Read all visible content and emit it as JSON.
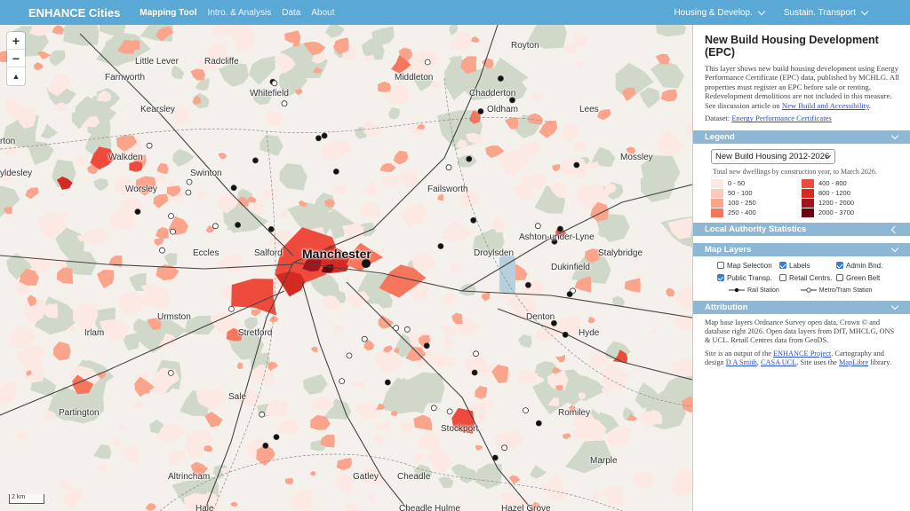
{
  "nav": {
    "brand": "ENHANCE Cities",
    "links": [
      "Mapping Tool",
      "Intro. & Analysis",
      "Data",
      "About"
    ],
    "dropdowns": [
      "Housing & Develop.",
      "Sustain. Transport"
    ]
  },
  "map": {
    "zoom_in": "+",
    "zoom_out": "−",
    "compass": "▲",
    "scale": "2 km",
    "places": [
      {
        "name": "Royton",
        "cls": ""
      },
      {
        "name": "Little Lever",
        "cls": ""
      },
      {
        "name": "Radcliffe",
        "cls": ""
      },
      {
        "name": "Farnworth",
        "cls": ""
      },
      {
        "name": "Middleton",
        "cls": ""
      },
      {
        "name": "Whitefield",
        "cls": ""
      },
      {
        "name": "Chadderton",
        "cls": ""
      },
      {
        "name": "Kearsley",
        "cls": ""
      },
      {
        "name": "Oldham",
        "cls": ""
      },
      {
        "name": "Lees",
        "cls": ""
      },
      {
        "name": "Walkden",
        "cls": ""
      },
      {
        "name": "Mossley",
        "cls": ""
      },
      {
        "name": "Swinton",
        "cls": ""
      },
      {
        "name": "Worsley",
        "cls": ""
      },
      {
        "name": "Failsworth",
        "cls": ""
      },
      {
        "name": "Ashton-under-Lyne",
        "cls": ""
      },
      {
        "name": "Eccles",
        "cls": ""
      },
      {
        "name": "Salford",
        "cls": ""
      },
      {
        "name": "Manchester",
        "cls": "city"
      },
      {
        "name": "Droylsden",
        "cls": ""
      },
      {
        "name": "Stalybridge",
        "cls": ""
      },
      {
        "name": "Dukinfield",
        "cls": ""
      },
      {
        "name": "Urmston",
        "cls": ""
      },
      {
        "name": "Denton",
        "cls": ""
      },
      {
        "name": "Irlam",
        "cls": ""
      },
      {
        "name": "Stretford",
        "cls": ""
      },
      {
        "name": "Hyde",
        "cls": ""
      },
      {
        "name": "Sale",
        "cls": ""
      },
      {
        "name": "Partington",
        "cls": ""
      },
      {
        "name": "Romiley",
        "cls": ""
      },
      {
        "name": "Stockport",
        "cls": ""
      },
      {
        "name": "Marple",
        "cls": ""
      },
      {
        "name": "Altrincham",
        "cls": ""
      },
      {
        "name": "Gatley",
        "cls": ""
      },
      {
        "name": "Cheadle",
        "cls": ""
      },
      {
        "name": "Hale",
        "cls": ""
      },
      {
        "name": "Cheadle Hulme",
        "cls": ""
      },
      {
        "name": "Hazel Grove",
        "cls": ""
      },
      {
        "name": "rton",
        "cls": ""
      },
      {
        "name": "yldesley",
        "cls": ""
      }
    ]
  },
  "panel": {
    "title": "New Build Housing Development (EPC)",
    "desc": "This layer shows new build housing development using Energy Performance Certificate (EPC) data, published by MCHLG. All properties must register an EPC before sale or renting. Redevelopment demolitions are not included in this measure. See discussion article on ",
    "desc_link": "New Build and Accessibility",
    "desc_end": ".",
    "dataset_label": "Dataset: ",
    "dataset_link": "Energy Performance Certificates"
  },
  "legend": {
    "header": "Legend",
    "select": "New Build Housing 2012-2026",
    "note": "Total new dwellings by construction year, to March 2026.",
    "classes": [
      {
        "label": "0 - 50",
        "color": "#fde9e4"
      },
      {
        "label": "400 - 800",
        "color": "#ef4b3c"
      },
      {
        "label": "50 - 100",
        "color": "#fcc9bb"
      },
      {
        "label": "800 - 1200",
        "color": "#d52a22"
      },
      {
        "label": "100 - 250",
        "color": "#fba48c"
      },
      {
        "label": "1200 - 2000",
        "color": "#a3141c"
      },
      {
        "label": "250 - 400",
        "color": "#f6765d"
      },
      {
        "label": "2000 - 3700",
        "color": "#680612"
      }
    ]
  },
  "la_stats": {
    "header": "Local Authority Statistics"
  },
  "layers": {
    "header": "Map Layers",
    "items": [
      {
        "label": "Map Selection",
        "on": false
      },
      {
        "label": "Labels",
        "on": true
      },
      {
        "label": "Admin Bnd.",
        "on": true
      },
      {
        "label": "Public Transp.",
        "on": true
      },
      {
        "label": "Retail Centrs.",
        "on": false
      },
      {
        "label": "Green Belt",
        "on": false
      }
    ],
    "rail_key": "Rail Station",
    "metro_key": "Metro/Tram Station"
  },
  "attribution": {
    "header": "Attribution",
    "p1": "Map base layers Ordnance Survey open data, Crown © and database right 2026. Open data layers from DfT, MHCLG, ONS & UCL. Retail Centres data from GeoDS.",
    "p2a": "Site is an output of the ",
    "p2_link": "ENHANCE Project",
    "p2b": ". Cartography and design ",
    "p2_link2": "D A Smith",
    "p2c": ", ",
    "p2_link3": "CASA UCL",
    "p2d": ". Site uses the ",
    "p2_link4": "MapLibre",
    "p2e": " library."
  },
  "colors": {
    "topbar": "#5aa8d6",
    "section_header": "#8cb8d6",
    "green": "#c9d5c2",
    "water": "#a8c8dc"
  }
}
